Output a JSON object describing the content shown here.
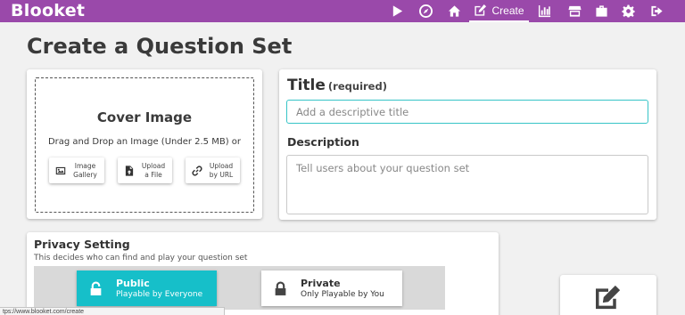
{
  "app": {
    "logo": "Blooket"
  },
  "nav": {
    "create_label": "Create",
    "icons": [
      "play-icon",
      "compass-icon",
      "home-icon",
      "edit-icon",
      "chart-icon",
      "store-icon",
      "briefcase-icon",
      "gear-icon",
      "logout-icon"
    ]
  },
  "page": {
    "title": "Create a Question Set"
  },
  "cover": {
    "title": "Cover Image",
    "subtitle": "Drag and Drop an Image (Under 2.5 MB) or",
    "buttons": [
      {
        "line1": "Image",
        "line2": "Gallery",
        "icon": "image-icon"
      },
      {
        "line1": "Upload",
        "line2": "a File",
        "icon": "file-upload-icon"
      },
      {
        "line1": "Upload",
        "line2": "by URL",
        "icon": "link-icon"
      }
    ]
  },
  "form": {
    "title_label": "Title",
    "title_required": "(required)",
    "title_placeholder": "Add a descriptive title",
    "title_value": "",
    "description_label": "Description",
    "description_placeholder": "Tell users about your question set",
    "description_value": ""
  },
  "privacy": {
    "title": "Privacy Setting",
    "subtitle": "This decides who can find and play your question set",
    "options": [
      {
        "title": "Public",
        "subtitle": "Playable by Everyone",
        "selected": true,
        "icon": "unlock-icon"
      },
      {
        "title": "Private",
        "subtitle": "Only Playable by You",
        "selected": false,
        "icon": "lock-icon"
      }
    ]
  },
  "status_bar": {
    "url": "tps://www.blooket.com/create"
  },
  "colors": {
    "topbar": "#9a49aa",
    "accent": "#16bfc9",
    "input_focus": "#36c4c7"
  }
}
